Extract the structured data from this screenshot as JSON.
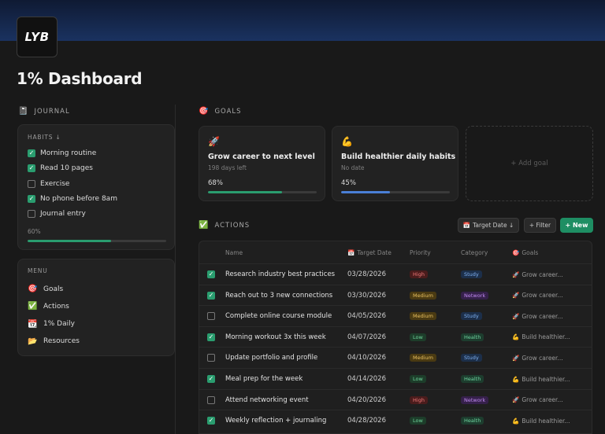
{
  "logo": "LYB",
  "page_title": "1% Dashboard",
  "journal": {
    "heading": "JOURNAL",
    "icon": "notebook-icon",
    "habits_title": "HABITS ↓",
    "habits": [
      {
        "label": "Morning routine",
        "done": true
      },
      {
        "label": "Read 10 pages",
        "done": true
      },
      {
        "label": "Exercise",
        "done": false
      },
      {
        "label": "No phone before 8am",
        "done": true
      },
      {
        "label": "Journal entry",
        "done": false
      }
    ],
    "progress_label": "60%",
    "progress": 0.6
  },
  "menu": {
    "title": "MENU",
    "items": [
      {
        "icon": "🎯",
        "label": "Goals"
      },
      {
        "icon": "✅",
        "label": "Actions"
      },
      {
        "icon": "📆",
        "label": "1% Daily"
      },
      {
        "icon": "📂",
        "label": "Resources"
      }
    ]
  },
  "goals": {
    "heading": "GOALS",
    "heading_icon": "🎯",
    "cards": [
      {
        "icon": "🚀",
        "name": "Grow career to next level",
        "sub": "198 days left",
        "pct_label": "68%",
        "progress": 0.68,
        "color": "#2a9d6f"
      },
      {
        "icon": "💪",
        "name": "Build healthier daily habits",
        "sub": "No date",
        "pct_label": "45%",
        "progress": 0.45,
        "color": "#4a7fd6"
      }
    ],
    "add_label": "+ Add goal"
  },
  "actions": {
    "heading": "ACTIONS",
    "heading_icon": "✅",
    "sort_label": "Target Date ↓",
    "filter_label": "+ Filter",
    "new_label": "+ New",
    "columns": {
      "name": "Name",
      "date": "Target Date",
      "priority": "Priority",
      "category": "Category",
      "goals": "Goals"
    },
    "rows": [
      {
        "done": true,
        "name": "Research industry best practices",
        "date": "03/28/2026",
        "priority": "High",
        "category": "Study",
        "goal_icon": "🚀",
        "goal": "Grow career..."
      },
      {
        "done": true,
        "name": "Reach out to 3 new connections",
        "date": "03/30/2026",
        "priority": "Medium",
        "category": "Network",
        "goal_icon": "🚀",
        "goal": "Grow career..."
      },
      {
        "done": false,
        "name": "Complete online course module",
        "date": "04/05/2026",
        "priority": "Medium",
        "category": "Study",
        "goal_icon": "🚀",
        "goal": "Grow career..."
      },
      {
        "done": true,
        "name": "Morning workout 3x this week",
        "date": "04/07/2026",
        "priority": "Low",
        "category": "Health",
        "goal_icon": "💪",
        "goal": "Build healthier..."
      },
      {
        "done": false,
        "name": "Update portfolio and profile",
        "date": "04/10/2026",
        "priority": "Medium",
        "category": "Study",
        "goal_icon": "🚀",
        "goal": "Grow career..."
      },
      {
        "done": true,
        "name": "Meal prep for the week",
        "date": "04/14/2026",
        "priority": "Low",
        "category": "Health",
        "goal_icon": "💪",
        "goal": "Build healthier..."
      },
      {
        "done": false,
        "name": "Attend networking event",
        "date": "04/20/2026",
        "priority": "High",
        "category": "Network",
        "goal_icon": "🚀",
        "goal": "Grow career..."
      },
      {
        "done": true,
        "name": "Weekly reflection + journaling",
        "date": "04/28/2026",
        "priority": "Low",
        "category": "Health",
        "goal_icon": "💪",
        "goal": "Build healthier..."
      }
    ]
  },
  "colors": {
    "accent": "#1e8e63",
    "priority": {
      "High": [
        "#4a1c1c",
        "#f07a7a"
      ],
      "Medium": [
        "#4a3a12",
        "#e8c060"
      ],
      "Low": [
        "#1d3d2a",
        "#6fd49a"
      ]
    },
    "category": {
      "Study": [
        "#1c2f4a",
        "#7fb0f0"
      ],
      "Network": [
        "#35204a",
        "#c08af0"
      ],
      "Health": [
        "#1d3d2e",
        "#6fd4a0"
      ]
    }
  }
}
